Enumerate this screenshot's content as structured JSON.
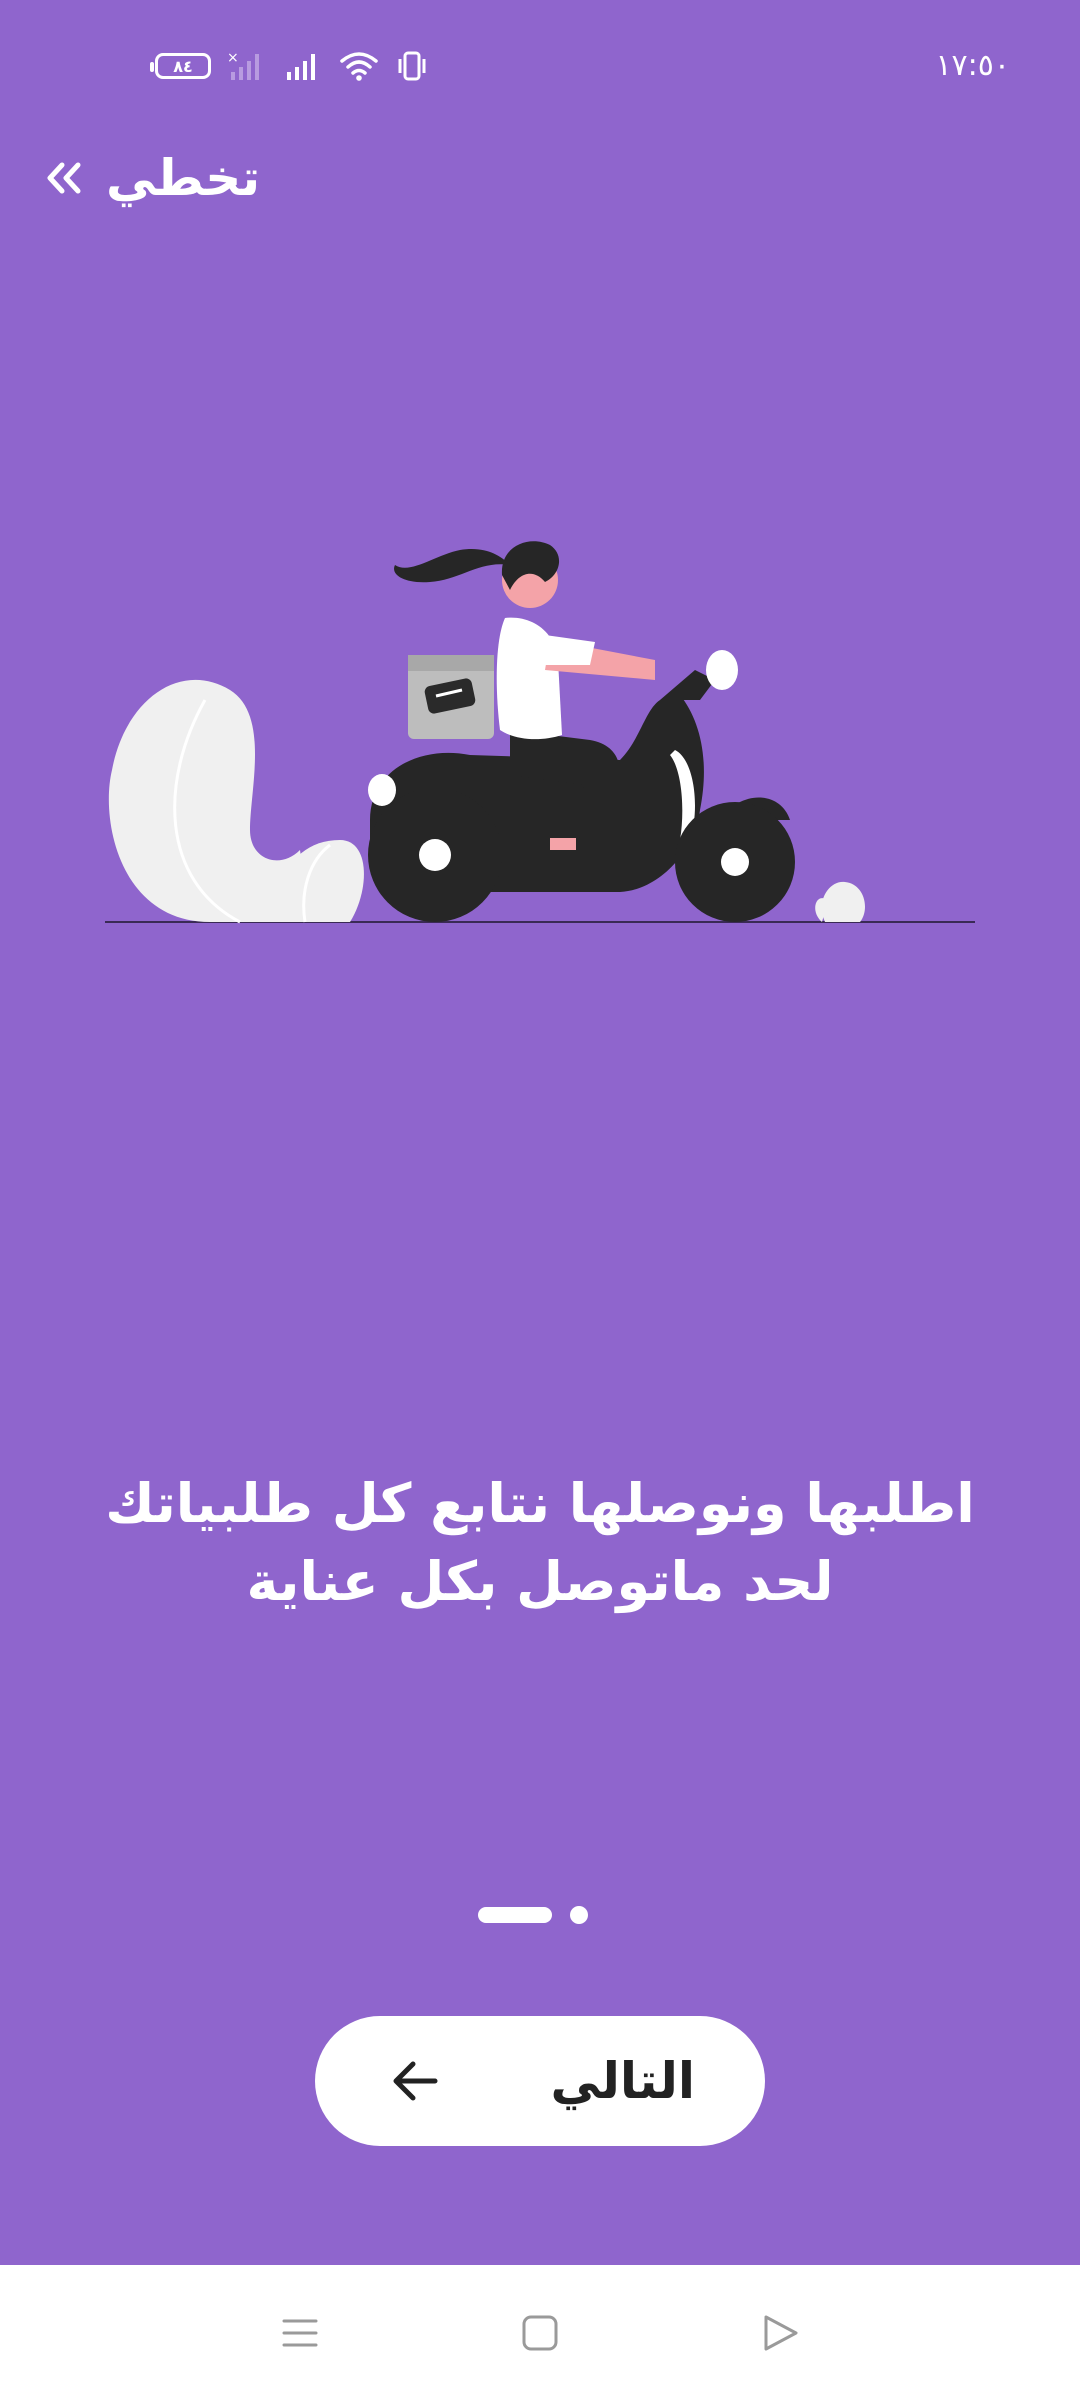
{
  "status_bar": {
    "time": "١٧:٥٠",
    "battery": "٨٤",
    "icons": [
      "battery-icon",
      "no-sim-signal-icon",
      "signal-icon",
      "wifi-icon",
      "vibrate-icon"
    ]
  },
  "skip": {
    "label": "تخطي",
    "icon": "double-chevron-left-icon"
  },
  "onboarding": {
    "message": "اطلبها ونوصلها نتابع كل طلبياتك لحد ماتوصل بكل عناية",
    "page_count": 2,
    "current_page": 1
  },
  "next_button": {
    "label": "التالي",
    "icon": "arrow-left-icon"
  },
  "colors": {
    "background": "#8F65CD",
    "button": "#FFFFFF",
    "text_dark": "#222222"
  },
  "nav_bar": {
    "icons": [
      "menu-icon",
      "home-square-icon",
      "back-triangle-icon"
    ]
  }
}
